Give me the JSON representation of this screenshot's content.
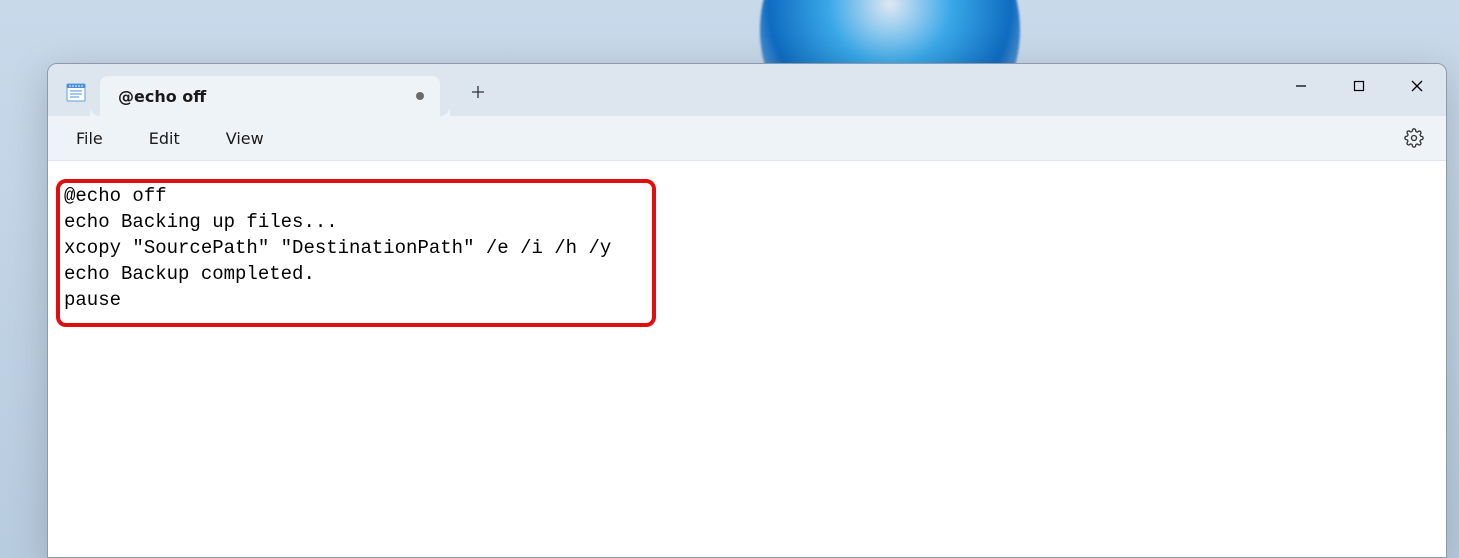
{
  "tab": {
    "title": "@echo off",
    "modified": true
  },
  "menubar": {
    "file": "File",
    "edit": "Edit",
    "view": "View"
  },
  "editor": {
    "content": "@echo off\necho Backing up files...\nxcopy \"SourcePath\" \"DestinationPath\" /e /i /h /y\necho Backup completed.\npause"
  }
}
